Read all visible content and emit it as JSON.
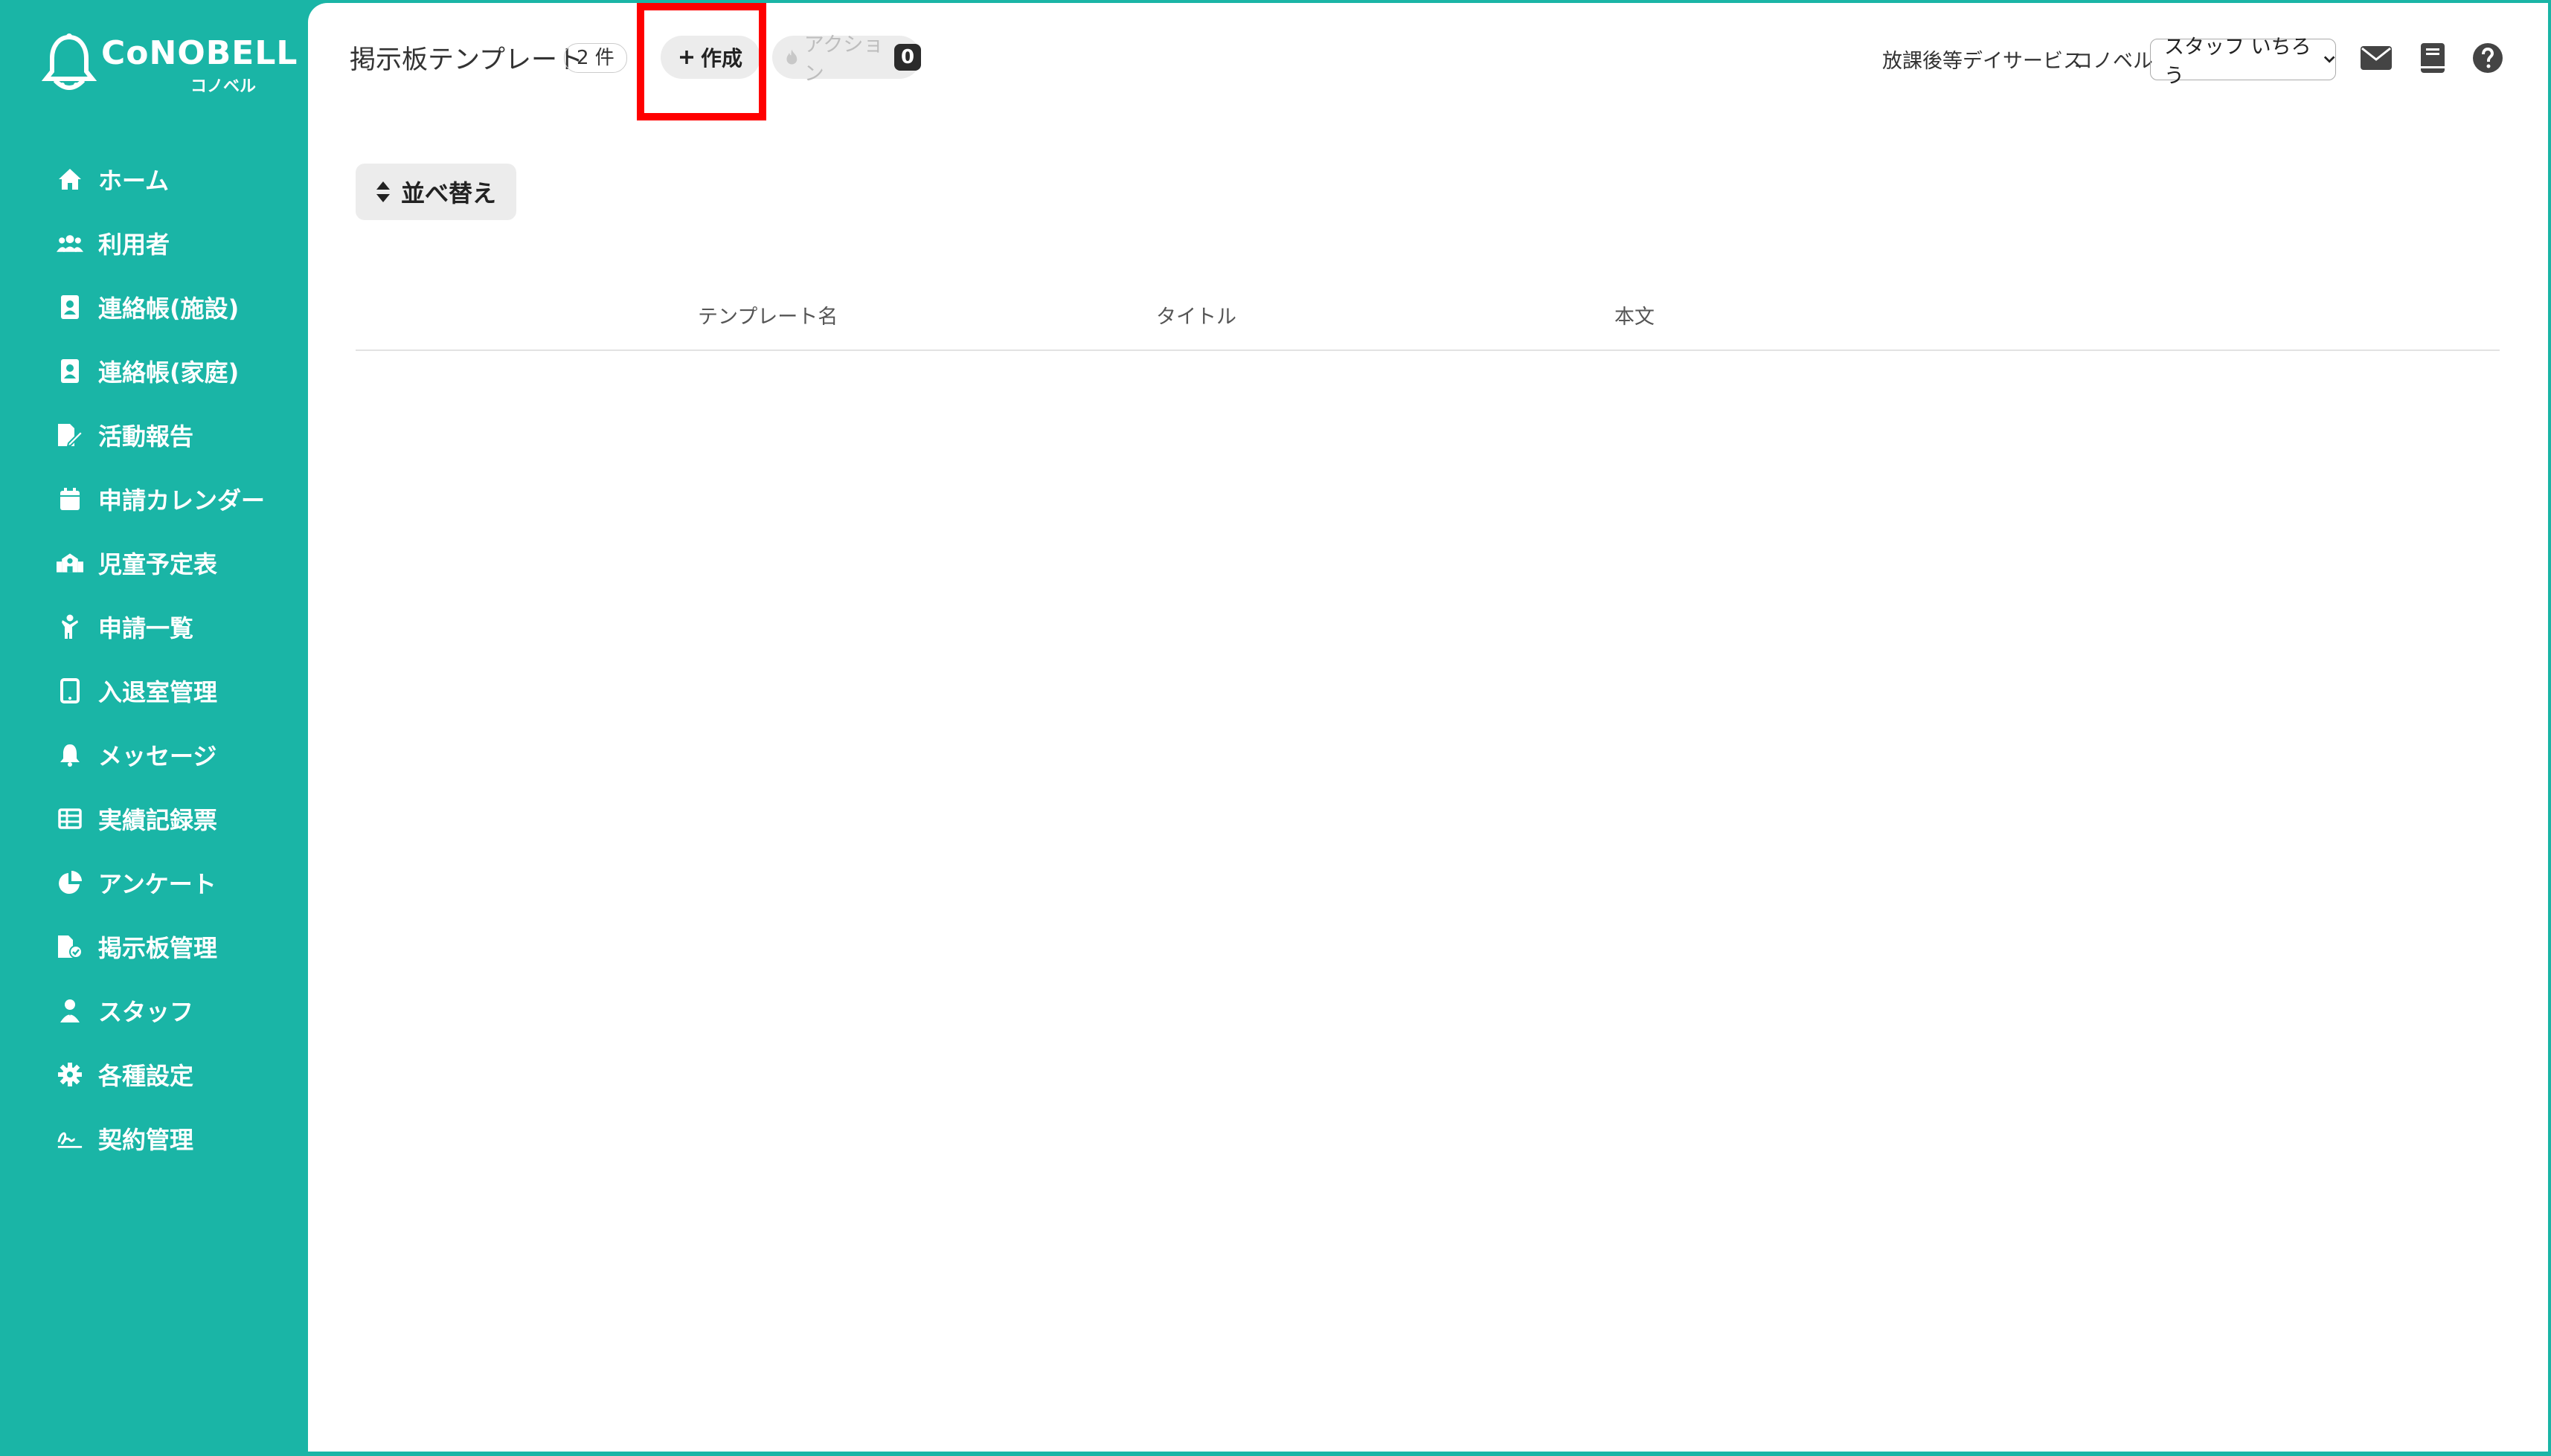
{
  "brand": {
    "logo_text": "CoNOBELL",
    "logo_sub": "コノベル"
  },
  "sidebar": {
    "items": [
      {
        "label": "ホーム",
        "icon": "home-icon"
      },
      {
        "label": "利用者",
        "icon": "users-icon"
      },
      {
        "label": "連絡帳(施設)",
        "icon": "contact-book-icon"
      },
      {
        "label": "連絡帳(家庭)",
        "icon": "contact-book-icon"
      },
      {
        "label": "活動報告",
        "icon": "report-edit-icon"
      },
      {
        "label": "申請カレンダー",
        "icon": "calendar-icon"
      },
      {
        "label": "児童予定表",
        "icon": "school-icon"
      },
      {
        "label": "申請一覧",
        "icon": "child-icon"
      },
      {
        "label": "入退室管理",
        "icon": "tablet-icon"
      },
      {
        "label": "メッセージ",
        "icon": "bell-icon"
      },
      {
        "label": "実績記録票",
        "icon": "table-icon"
      },
      {
        "label": "アンケート",
        "icon": "pie-chart-icon"
      },
      {
        "label": "掲示板管理",
        "icon": "board-file-icon"
      },
      {
        "label": "スタッフ",
        "icon": "staff-icon"
      },
      {
        "label": "各種設定",
        "icon": "gear-icon"
      },
      {
        "label": "契約管理",
        "icon": "signature-icon"
      }
    ]
  },
  "header": {
    "title": "掲示板テンプレート",
    "count": "2 件",
    "create_label": "作成",
    "action_label": "アクション",
    "action_count": "0",
    "facility": "放課後等デイサービス",
    "company": "コノベル",
    "staff_select": "スタッフ いちろう"
  },
  "toolbar": {
    "sort_label": "並べ替え"
  },
  "table": {
    "columns": [
      "テンプレート名",
      "タイトル",
      "本文"
    ],
    "rows": []
  },
  "colors": {
    "brand": "#1ab5a6",
    "highlight": "#ff0000"
  }
}
